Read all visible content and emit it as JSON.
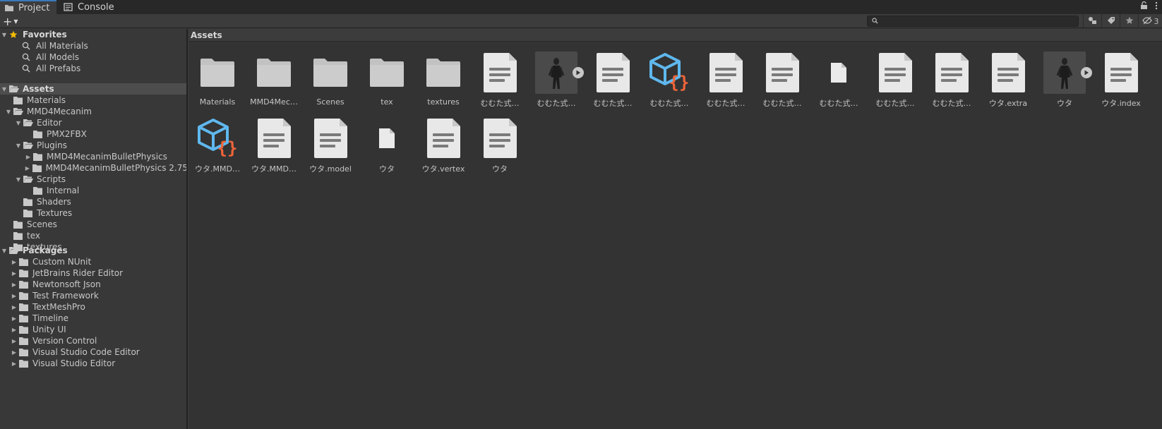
{
  "tabs": [
    {
      "label": "Project",
      "icon": "folder-icon",
      "active": true
    },
    {
      "label": "Console",
      "icon": "console-icon",
      "active": false
    }
  ],
  "tabbar_right": {
    "lock_icon": "lock-icon",
    "menu_icon": "kebab-menu-icon"
  },
  "toolbar": {
    "add_label": "+",
    "search_placeholder": "",
    "hidden_packages_count": "3"
  },
  "sidebar": {
    "favorites": {
      "label": "Favorites",
      "items": [
        "All Materials",
        "All Models",
        "All Prefabs"
      ]
    },
    "assets": {
      "label": "Assets",
      "tree": [
        {
          "label": "Materials",
          "depth": 1,
          "expandable": false,
          "open": false
        },
        {
          "label": "MMD4Mecanim",
          "depth": 1,
          "expandable": true,
          "open": true
        },
        {
          "label": "Editor",
          "depth": 2,
          "expandable": true,
          "open": true
        },
        {
          "label": "PMX2FBX",
          "depth": 3,
          "expandable": false,
          "open": false
        },
        {
          "label": "Plugins",
          "depth": 2,
          "expandable": true,
          "open": true
        },
        {
          "label": "MMD4MecanimBulletPhysics",
          "depth": 3,
          "expandable": true,
          "open": false
        },
        {
          "label": "MMD4MecanimBulletPhysics 2.75",
          "depth": 3,
          "expandable": true,
          "open": false
        },
        {
          "label": "Scripts",
          "depth": 2,
          "expandable": true,
          "open": true
        },
        {
          "label": "Internal",
          "depth": 3,
          "expandable": false,
          "open": false
        },
        {
          "label": "Shaders",
          "depth": 2,
          "expandable": false,
          "open": false
        },
        {
          "label": "Textures",
          "depth": 2,
          "expandable": false,
          "open": false
        },
        {
          "label": "Scenes",
          "depth": 1,
          "expandable": false,
          "open": false
        },
        {
          "label": "tex",
          "depth": 1,
          "expandable": false,
          "open": false
        },
        {
          "label": "textures",
          "depth": 1,
          "expandable": false,
          "open": false
        }
      ]
    },
    "packages": {
      "label": "Packages",
      "items": [
        "Custom NUnit",
        "JetBrains Rider Editor",
        "Newtonsoft Json",
        "Test Framework",
        "TextMeshPro",
        "Timeline",
        "Unity UI",
        "Version Control",
        "Visual Studio Code Editor",
        "Visual Studio Editor"
      ]
    }
  },
  "main": {
    "breadcrumb": "Assets",
    "items": [
      {
        "label": "Materials",
        "kind": "folder"
      },
      {
        "label": "MMD4Mec…",
        "kind": "folder"
      },
      {
        "label": "Scenes",
        "kind": "folder"
      },
      {
        "label": "tex",
        "kind": "folder"
      },
      {
        "label": "textures",
        "kind": "folder"
      },
      {
        "label": "むむた式…",
        "kind": "text"
      },
      {
        "label": "むむた式…",
        "kind": "model"
      },
      {
        "label": "むむた式…",
        "kind": "text"
      },
      {
        "label": "むむた式…",
        "kind": "script"
      },
      {
        "label": "むむた式…",
        "kind": "text"
      },
      {
        "label": "むむた式…",
        "kind": "text"
      },
      {
        "label": "むむた式…",
        "kind": "file"
      },
      {
        "label": "むむた式…",
        "kind": "text"
      },
      {
        "label": "むむた式…",
        "kind": "text"
      },
      {
        "label": "ウタ.extra",
        "kind": "text"
      },
      {
        "label": "ウタ",
        "kind": "model"
      },
      {
        "label": "ウタ.index",
        "kind": "text"
      },
      {
        "label": "ウタ.MMD…",
        "kind": "script"
      },
      {
        "label": "ウタ.MMD…",
        "kind": "text"
      },
      {
        "label": "ウタ.model",
        "kind": "text"
      },
      {
        "label": "ウタ",
        "kind": "file"
      },
      {
        "label": "ウタ.vertex",
        "kind": "text"
      },
      {
        "label": "ウタ",
        "kind": "text"
      }
    ]
  },
  "colors": {
    "accent": "#3a79bb",
    "favorite_star": "#f4bc02",
    "script_cube": "#5fb8ee",
    "script_braces": "#f0653a"
  }
}
